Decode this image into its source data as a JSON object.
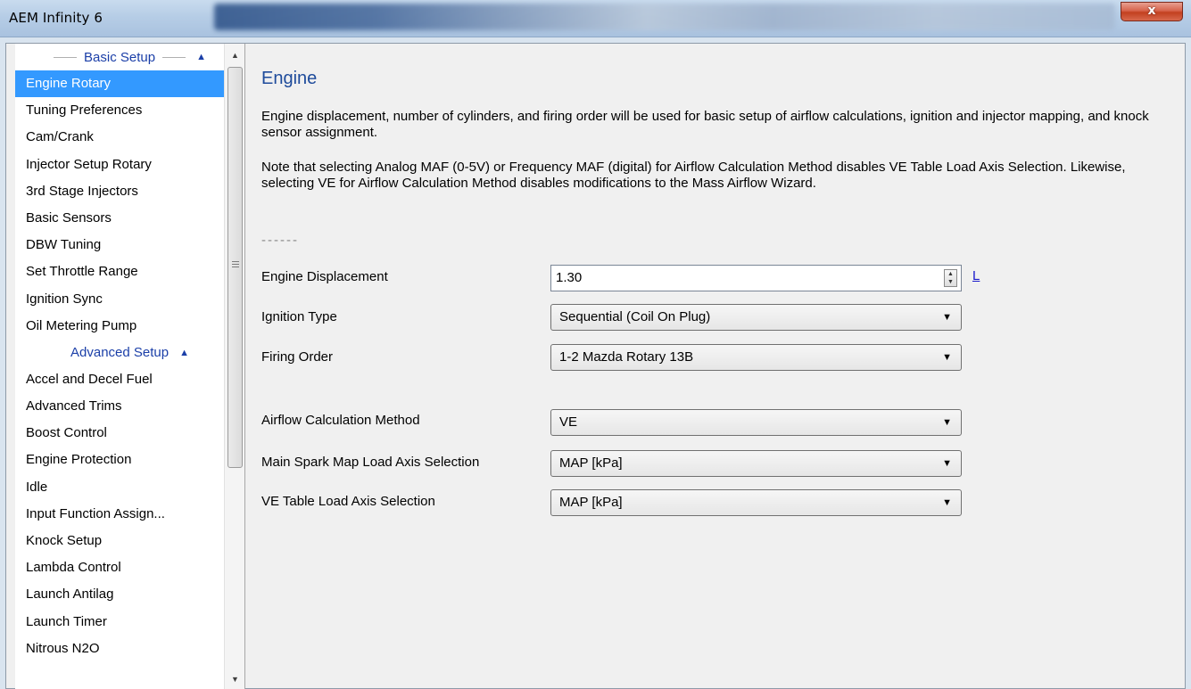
{
  "window": {
    "title": "AEM Infinity 6",
    "close_label": "x"
  },
  "sidebar": {
    "sections": [
      {
        "header": "Basic Setup",
        "items": [
          "Engine Rotary",
          "Tuning Preferences",
          "Cam/Crank",
          "Injector Setup Rotary",
          "3rd Stage Injectors",
          "Basic Sensors",
          "DBW Tuning",
          "Set Throttle Range",
          "Ignition Sync",
          "Oil Metering Pump"
        ]
      },
      {
        "header": "Advanced Setup",
        "items": [
          "Accel and Decel Fuel",
          "Advanced Trims",
          "Boost Control",
          "Engine Protection",
          "Idle",
          "Input Function Assign...",
          "Knock Setup",
          "Lambda Control",
          "Launch Antilag",
          "Launch Timer",
          "Nitrous N2O"
        ]
      }
    ],
    "selected": "Engine Rotary"
  },
  "main": {
    "title": "Engine",
    "description": "Engine displacement, number of cylinders, and firing order will be used for basic setup of airflow calculations, ignition and injector mapping, and knock sensor assignment.",
    "note": "Note that selecting Analog MAF (0-5V) or Frequency MAF (digital) for Airflow Calculation Method disables VE Table Load Axis Selection. Likewise, selecting VE for Airflow Calculation Method disables modifications to the Mass Airflow Wizard.",
    "separator": "------",
    "fields": {
      "displacement": {
        "label": "Engine Displacement",
        "value": "1.30",
        "unit": "L"
      },
      "ignition_type": {
        "label": "Ignition Type",
        "value": "Sequential (Coil On Plug)"
      },
      "firing_order": {
        "label": "Firing Order",
        "value": "1-2 Mazda Rotary 13B"
      },
      "airflow_method": {
        "label": "Airflow Calculation Method",
        "value": "VE"
      },
      "spark_load_axis": {
        "label": "Main Spark Map Load Axis Selection",
        "value": "MAP [kPa]"
      },
      "ve_load_axis": {
        "label": "VE Table Load Axis Selection",
        "value": "MAP [kPa]"
      }
    }
  }
}
